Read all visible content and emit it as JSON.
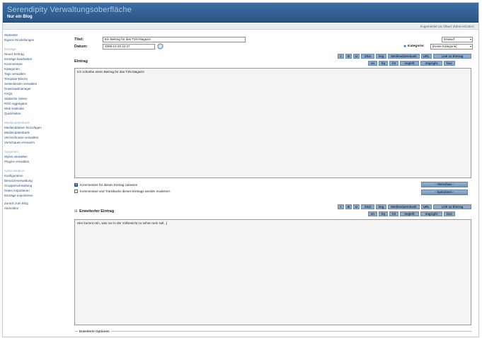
{
  "banner": {
    "title": "Serendipity Verwaltungsoberfläche",
    "subtitle": "Nur ein Blog"
  },
  "userbar": {
    "text": "Angemeldet als Ulbert (Administrator)"
  },
  "sidebar": {
    "top": [
      "Startseite",
      "Eigene Einstellungen"
    ],
    "groups": [
      {
        "head": "Einträge",
        "items": [
          "Neuer Eintrag",
          "Einträge bearbeiten",
          "Kommentare",
          "Kategorien",
          "Tags verwalten",
          "Template-Blocks",
          "Seitenleisten verwalten",
          "Downloadmanager",
          "FAQs",
          "Statische Seiten",
          "RSS Aggregator",
          "Web Kalender",
          "QuickNotes"
        ]
      },
      {
        "head": "Mediendatenbank",
        "items": [
          "Mediendateien hinzufügen",
          "Mediendatenbank",
          "Verzeichnisse verwalten",
          "Vorschauen erneuern"
        ]
      },
      {
        "head": "Aussehen",
        "items": [
          "Styles verwalten",
          "Plugins verwalten"
        ]
      },
      {
        "head": "Administration",
        "items": [
          "Konfiguration",
          "Benutzerverwaltung",
          "Gruppenverwaltung",
          "Daten importieren",
          "Einträge exportieren"
        ]
      }
    ],
    "bottom": [
      "Zurück zum Blog",
      "Abmelden"
    ]
  },
  "form": {
    "title_label": "Titel:",
    "title_value": "Ein Beitrag für das T3N Magazin",
    "date_label": "Datum:",
    "date_value": "2008-10-20 22:27",
    "status_value": "Entwurf",
    "category_label": "Kategorie:",
    "category_value": "[Keine Kategorie]",
    "entry_label": "Eintrag",
    "entry_text": "Ich schreibe einen Beitrag für das T3N Magazin",
    "extended_label": "Erweiterter Eintrag",
    "extended_text": "Hier kommt rein, was nur in der Vollansicht zu sehen sein soll...]",
    "allow_comments": "Kommentare für diesen Eintrag zulassen",
    "moderate": "Kommentare und Trackbacks dieses Eintrags werden moderiert.",
    "preview_button": "- Vorschau -",
    "save_button": "- Speichern -",
    "advanced_options": "Erweiterte Optionen"
  },
  "toolbar": {
    "row1": [
      "I",
      "B",
      "U",
      "Zitat",
      "img",
      "Mediendatenbank",
      "URL",
      "Link zu Eintrag"
    ],
    "row2": [
      "en",
      "bq",
      "h3",
      "imgleft",
      "imgright",
      "box"
    ]
  },
  "colors": {
    "banner": "#2f5d90",
    "accent": "#8fa9c8",
    "link": "#2a4f7d"
  }
}
